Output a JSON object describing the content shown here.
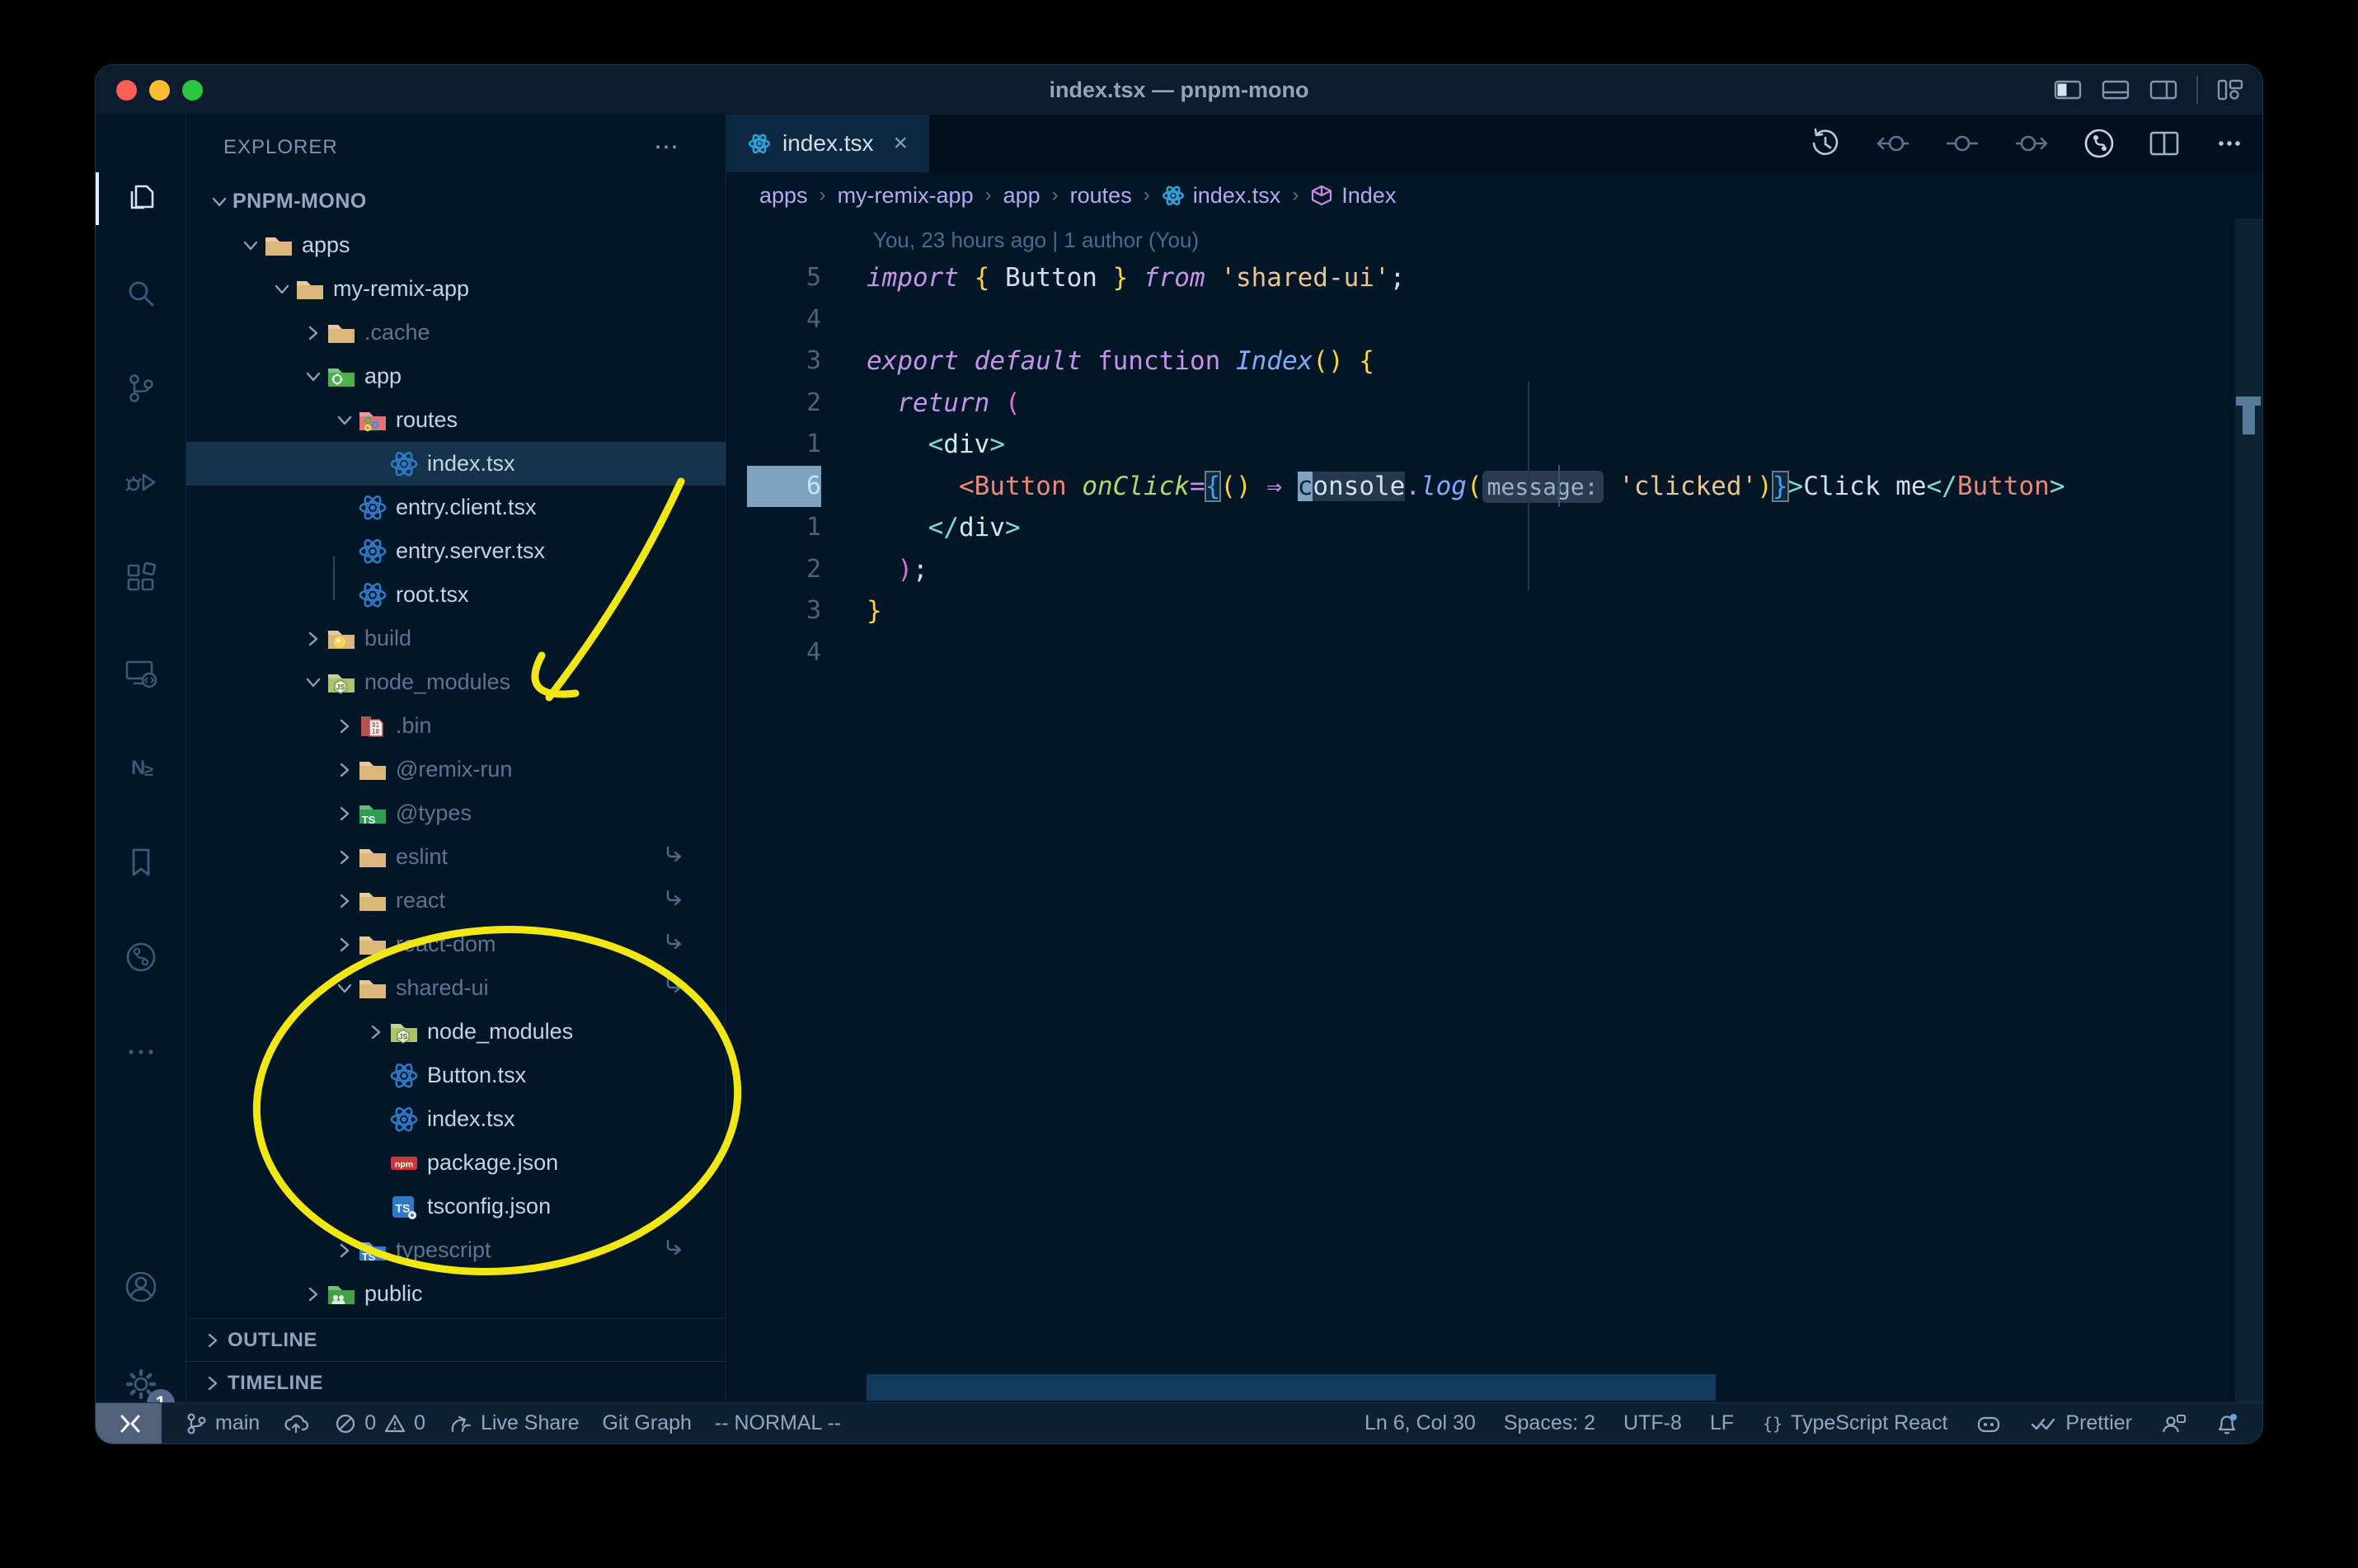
{
  "window": {
    "title": "index.tsx — pnpm-mono"
  },
  "colors": {
    "window_bg": "#011627",
    "selection_row": "#153349",
    "active_tab": "#0d2942",
    "status_remote_bg": "#51617a",
    "annotation_yellow": "#f2e713",
    "gold": "#ffd23e",
    "magenta": "#c792ea",
    "string_peach": "#ecc48d",
    "teal": "#7fdbca",
    "coral": "#f08877",
    "green_attr": "#addb67",
    "blue_fn": "#82aaff",
    "react_blue": "#2d79c7",
    "npm_red": "#cb3837",
    "folder_tan": "#dcb67a"
  },
  "title_bar": {
    "layout_icons": [
      "panel-left",
      "panel-bottom",
      "panel-right",
      "customize-layout"
    ]
  },
  "activity_bar": {
    "items": [
      {
        "name": "explorer",
        "active": true
      },
      {
        "name": "search",
        "active": false
      },
      {
        "name": "source-control",
        "active": false
      },
      {
        "name": "run-debug",
        "active": false
      },
      {
        "name": "extensions",
        "active": false
      },
      {
        "name": "remote-explorer",
        "active": false
      },
      {
        "name": "nx-console",
        "active": false
      },
      {
        "name": "bookmarks",
        "active": false
      },
      {
        "name": "git-graph",
        "active": false
      },
      {
        "name": "more",
        "active": false
      }
    ],
    "account": "account",
    "settings": "settings",
    "settings_badge": "1"
  },
  "sidebar": {
    "header": "EXPLORER",
    "header_actions": "⋯",
    "tree": [
      {
        "label": "PNPM-MONO",
        "indent": 0,
        "icon": null,
        "chevron": "down",
        "root": true
      },
      {
        "label": "apps",
        "indent": 1,
        "icon": "folder",
        "chevron": "down"
      },
      {
        "label": "my-remix-app",
        "indent": 2,
        "icon": "folder",
        "chevron": "down"
      },
      {
        "label": ".cache",
        "indent": 3,
        "icon": "folder",
        "chevron": "right",
        "dimmed": true
      },
      {
        "label": "app",
        "indent": 3,
        "icon": "folder-app",
        "chevron": "down"
      },
      {
        "label": "routes",
        "indent": 4,
        "icon": "folder-routes",
        "chevron": "down"
      },
      {
        "label": "index.tsx",
        "indent": 5,
        "icon": "react",
        "selected": true
      },
      {
        "label": "entry.client.tsx",
        "indent": 4,
        "icon": "react"
      },
      {
        "label": "entry.server.tsx",
        "indent": 4,
        "icon": "react"
      },
      {
        "label": "root.tsx",
        "indent": 4,
        "icon": "react"
      },
      {
        "label": "build",
        "indent": 3,
        "icon": "folder-build",
        "chevron": "right",
        "dimmed": true
      },
      {
        "label": "node_modules",
        "indent": 3,
        "icon": "folder-node",
        "chevron": "down",
        "dimmed": true
      },
      {
        "label": ".bin",
        "indent": 4,
        "icon": "folder-bin",
        "chevron": "right",
        "dimmed": true
      },
      {
        "label": "@remix-run",
        "indent": 4,
        "icon": "folder",
        "chevron": "right",
        "dimmed": true
      },
      {
        "label": "@types",
        "indent": 4,
        "icon": "folder-types",
        "chevron": "right",
        "dimmed": true
      },
      {
        "label": "eslint",
        "indent": 4,
        "icon": "folder",
        "chevron": "right",
        "dimmed": true,
        "symlink": true
      },
      {
        "label": "react",
        "indent": 4,
        "icon": "folder",
        "chevron": "right",
        "dimmed": true,
        "symlink": true
      },
      {
        "label": "react-dom",
        "indent": 4,
        "icon": "folder",
        "chevron": "right",
        "dimmed": true,
        "symlink": true
      },
      {
        "label": "shared-ui",
        "indent": 4,
        "icon": "folder",
        "chevron": "down",
        "dimmed": true,
        "symlink": true
      },
      {
        "label": "node_modules",
        "indent": 5,
        "icon": "folder-node",
        "chevron": "right"
      },
      {
        "label": "Button.tsx",
        "indent": 5,
        "icon": "react"
      },
      {
        "label": "index.tsx",
        "indent": 5,
        "icon": "react"
      },
      {
        "label": "package.json",
        "indent": 5,
        "icon": "npm"
      },
      {
        "label": "tsconfig.json",
        "indent": 5,
        "icon": "tsconfig"
      },
      {
        "label": "typescript",
        "indent": 4,
        "icon": "folder-ts",
        "chevron": "right",
        "dimmed": true,
        "symlink": true
      },
      {
        "label": "public",
        "indent": 3,
        "icon": "folder-public",
        "chevron": "right"
      }
    ],
    "sections": [
      "OUTLINE",
      "TIMELINE"
    ]
  },
  "tab_bar": {
    "tabs": [
      {
        "label": "index.tsx",
        "icon": "react",
        "close": "×",
        "active": true
      }
    ],
    "actions": [
      "history",
      "prev-change",
      "change",
      "next-change",
      "git-circle",
      "split-editor",
      "more"
    ]
  },
  "breadcrumbs": {
    "separator": "›",
    "items": [
      {
        "label": "apps"
      },
      {
        "label": "my-remix-app"
      },
      {
        "label": "app"
      },
      {
        "label": "routes"
      },
      {
        "label": "index.tsx",
        "icon": "react"
      },
      {
        "label": "Index",
        "icon": "symbol-module"
      }
    ]
  },
  "editor": {
    "blame": "You, 23 hours ago | 1 author (You)",
    "lines": [
      {
        "n": "5",
        "t": [
          [
            "kwi",
            "import"
          ],
          [
            "wh",
            " "
          ],
          [
            "b1",
            "{"
          ],
          [
            "wh",
            " Button "
          ],
          [
            "b1",
            "}"
          ],
          [
            "wh",
            " "
          ],
          [
            "kwi",
            "from"
          ],
          [
            "wh",
            " "
          ],
          [
            "str",
            "'shared-ui'"
          ],
          [
            "wh",
            ";"
          ]
        ]
      },
      {
        "n": "4",
        "t": []
      },
      {
        "n": "3",
        "t": [
          [
            "kwi",
            "export"
          ],
          [
            "wh",
            " "
          ],
          [
            "kwi",
            "default"
          ],
          [
            "wh",
            " "
          ],
          [
            "kw",
            "function"
          ],
          [
            "wh",
            " "
          ],
          [
            "fn",
            "Index"
          ],
          [
            "b1",
            "()"
          ],
          [
            "wh",
            " "
          ],
          [
            "b1",
            "{"
          ]
        ]
      },
      {
        "n": "2",
        "t": [
          [
            "wh",
            "  "
          ],
          [
            "kwi",
            "return"
          ],
          [
            "wh",
            " "
          ],
          [
            "b2",
            "("
          ]
        ]
      },
      {
        "n": "1",
        "t": [
          [
            "wh",
            "    "
          ],
          [
            "tp",
            "<"
          ],
          [
            "tn",
            "div"
          ],
          [
            "tp",
            ">"
          ]
        ]
      },
      {
        "n": "6",
        "cur": true,
        "t": [
          [
            "wh",
            "      "
          ],
          [
            "comp",
            "<Button"
          ],
          [
            "wh",
            " "
          ],
          [
            "attr",
            "onClick"
          ],
          [
            "op",
            "="
          ],
          [
            "b3 match",
            "{"
          ],
          [
            "b1",
            "()"
          ],
          [
            "wh",
            " "
          ],
          [
            "arrow",
            "⇒"
          ],
          [
            "wh",
            " "
          ],
          [
            "cur",
            "c"
          ],
          [
            "hl",
            "onsole"
          ],
          [
            "dot",
            "."
          ],
          [
            "fn",
            "log"
          ],
          [
            "b1",
            "("
          ],
          [
            "hint",
            "message:"
          ],
          [
            "wh",
            " "
          ],
          [
            "str",
            "'clicked'"
          ],
          [
            "b1",
            ")"
          ],
          [
            "b3 match",
            "}"
          ],
          [
            "tp",
            ">"
          ],
          [
            "wh",
            "Click me"
          ],
          [
            "tp",
            "</"
          ],
          [
            "comp",
            "Button"
          ],
          [
            "tp",
            ">"
          ]
        ]
      },
      {
        "n": "1",
        "t": [
          [
            "wh",
            "    "
          ],
          [
            "tp",
            "</"
          ],
          [
            "tn",
            "div"
          ],
          [
            "tp",
            ">"
          ]
        ]
      },
      {
        "n": "2",
        "t": [
          [
            "wh",
            "  "
          ],
          [
            "b2",
            ")"
          ],
          [
            "wh",
            ";"
          ]
        ]
      },
      {
        "n": "3",
        "t": [
          [
            "b1",
            "}"
          ]
        ]
      },
      {
        "n": "4",
        "t": []
      }
    ]
  },
  "status_bar": {
    "left": [
      {
        "icon": "remote",
        "remote": true,
        "name": "remote-indicator"
      },
      {
        "icon": "branch",
        "label": "main",
        "name": "git-branch"
      },
      {
        "icon": "cloud-upload",
        "name": "sync"
      },
      {
        "icon": "error",
        "label": "0",
        "icon2": "warning",
        "label2": "0",
        "name": "problems"
      },
      {
        "icon": "live-share",
        "label": "Live Share",
        "name": "live-share"
      },
      {
        "label": "Git Graph",
        "name": "git-graph"
      },
      {
        "label": "-- NORMAL --",
        "name": "vim-mode"
      }
    ],
    "right": [
      {
        "label": "Ln 6, Col 30",
        "name": "cursor-position"
      },
      {
        "label": "Spaces: 2",
        "name": "indentation"
      },
      {
        "label": "UTF-8",
        "name": "encoding"
      },
      {
        "label": "LF",
        "name": "eol"
      },
      {
        "icon": "braces",
        "label": "TypeScript React",
        "name": "language-mode"
      },
      {
        "icon": "copilot",
        "name": "copilot"
      },
      {
        "icon": "double-check",
        "label": "Prettier",
        "name": "formatter"
      },
      {
        "icon": "feedback",
        "name": "feedback"
      },
      {
        "icon": "bell-dot",
        "name": "notifications"
      }
    ]
  }
}
